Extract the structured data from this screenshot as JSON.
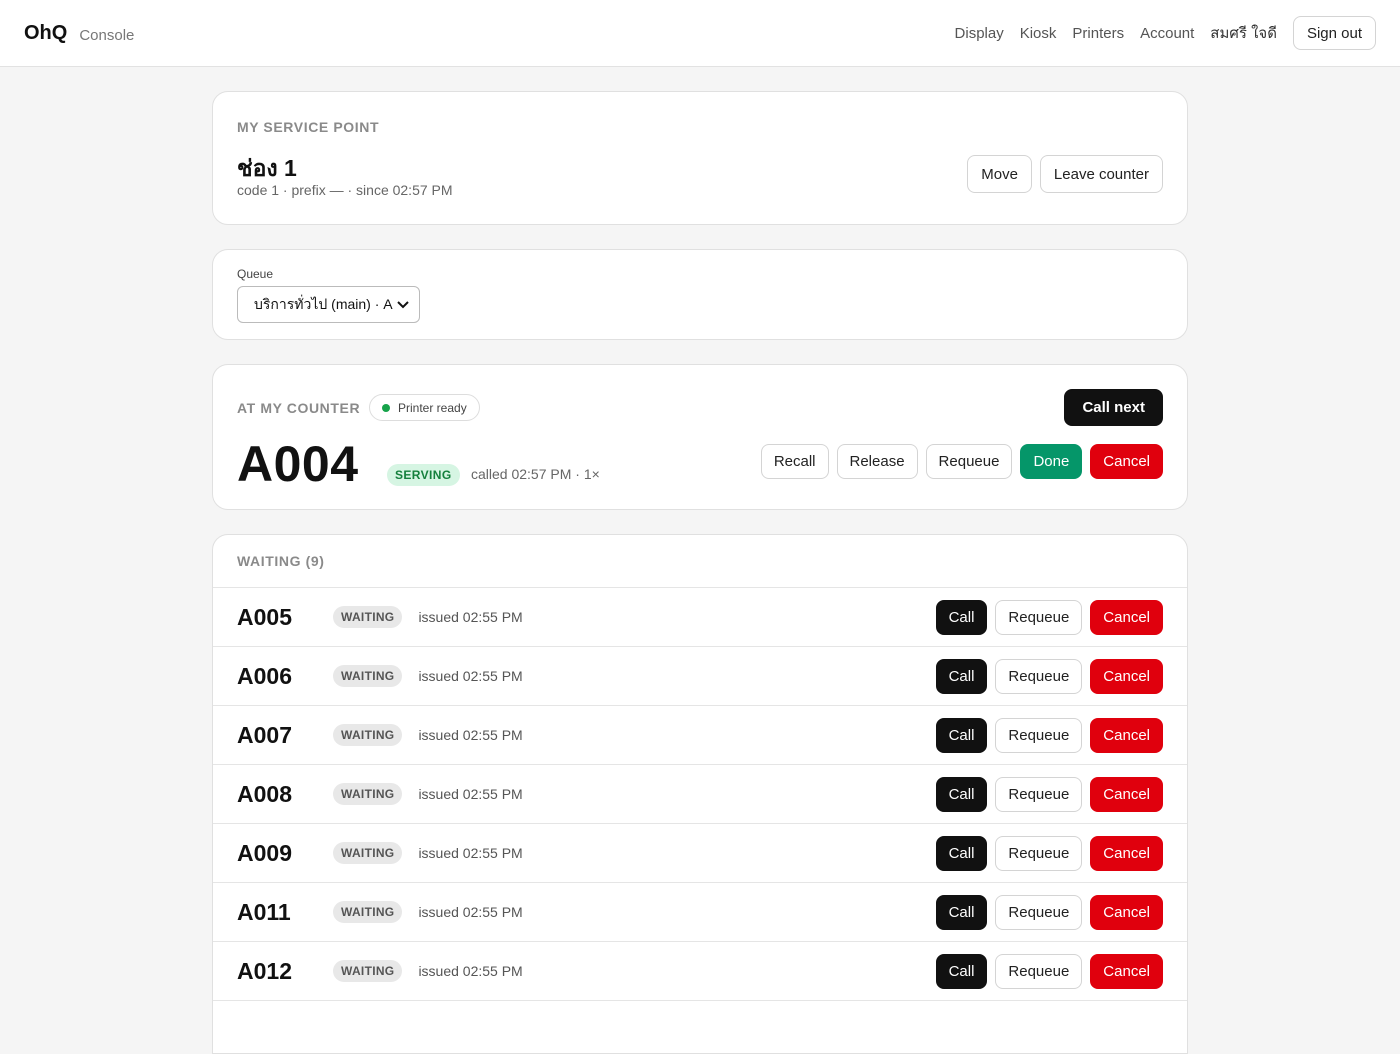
{
  "header": {
    "brand": "OhQ",
    "subtitle": "Console",
    "nav": [
      "Display",
      "Kiosk",
      "Printers",
      "Account"
    ],
    "user_name": "สมศรี ใจดี",
    "sign_out_label": "Sign out"
  },
  "service_point": {
    "section_label": "MY SERVICE POINT",
    "name": "ช่อง 1",
    "meta": "code 1 · prefix — · since 02:57 PM",
    "move_label": "Move",
    "leave_label": "Leave counter"
  },
  "queue": {
    "label": "Queue",
    "selected": "บริการทั่วไป (main) · A"
  },
  "counter": {
    "section_label": "AT MY COUNTER",
    "printer_status": "Printer ready",
    "printer_status_color": "#16a34a",
    "call_next_label": "Call next",
    "ticket": "A004",
    "status": "SERVING",
    "called_meta": "called 02:57 PM · 1×",
    "actions": {
      "recall": "Recall",
      "release": "Release",
      "requeue": "Requeue",
      "done": "Done",
      "cancel": "Cancel"
    }
  },
  "waiting": {
    "section_label": "WAITING (9)",
    "status_label": "WAITING",
    "call_label": "Call",
    "requeue_label": "Requeue",
    "cancel_label": "Cancel",
    "rows": [
      {
        "ticket": "A005",
        "issued": "issued 02:55 PM"
      },
      {
        "ticket": "A006",
        "issued": "issued 02:55 PM"
      },
      {
        "ticket": "A007",
        "issued": "issued 02:55 PM"
      },
      {
        "ticket": "A008",
        "issued": "issued 02:55 PM"
      },
      {
        "ticket": "A009",
        "issued": "issued 02:55 PM"
      },
      {
        "ticket": "A011",
        "issued": "issued 02:55 PM"
      },
      {
        "ticket": "A012",
        "issued": "issued 02:55 PM"
      }
    ]
  },
  "colors": {
    "primary": "#111111",
    "success": "#059669",
    "danger": "#e0000d",
    "background": "#f5f5f5"
  }
}
